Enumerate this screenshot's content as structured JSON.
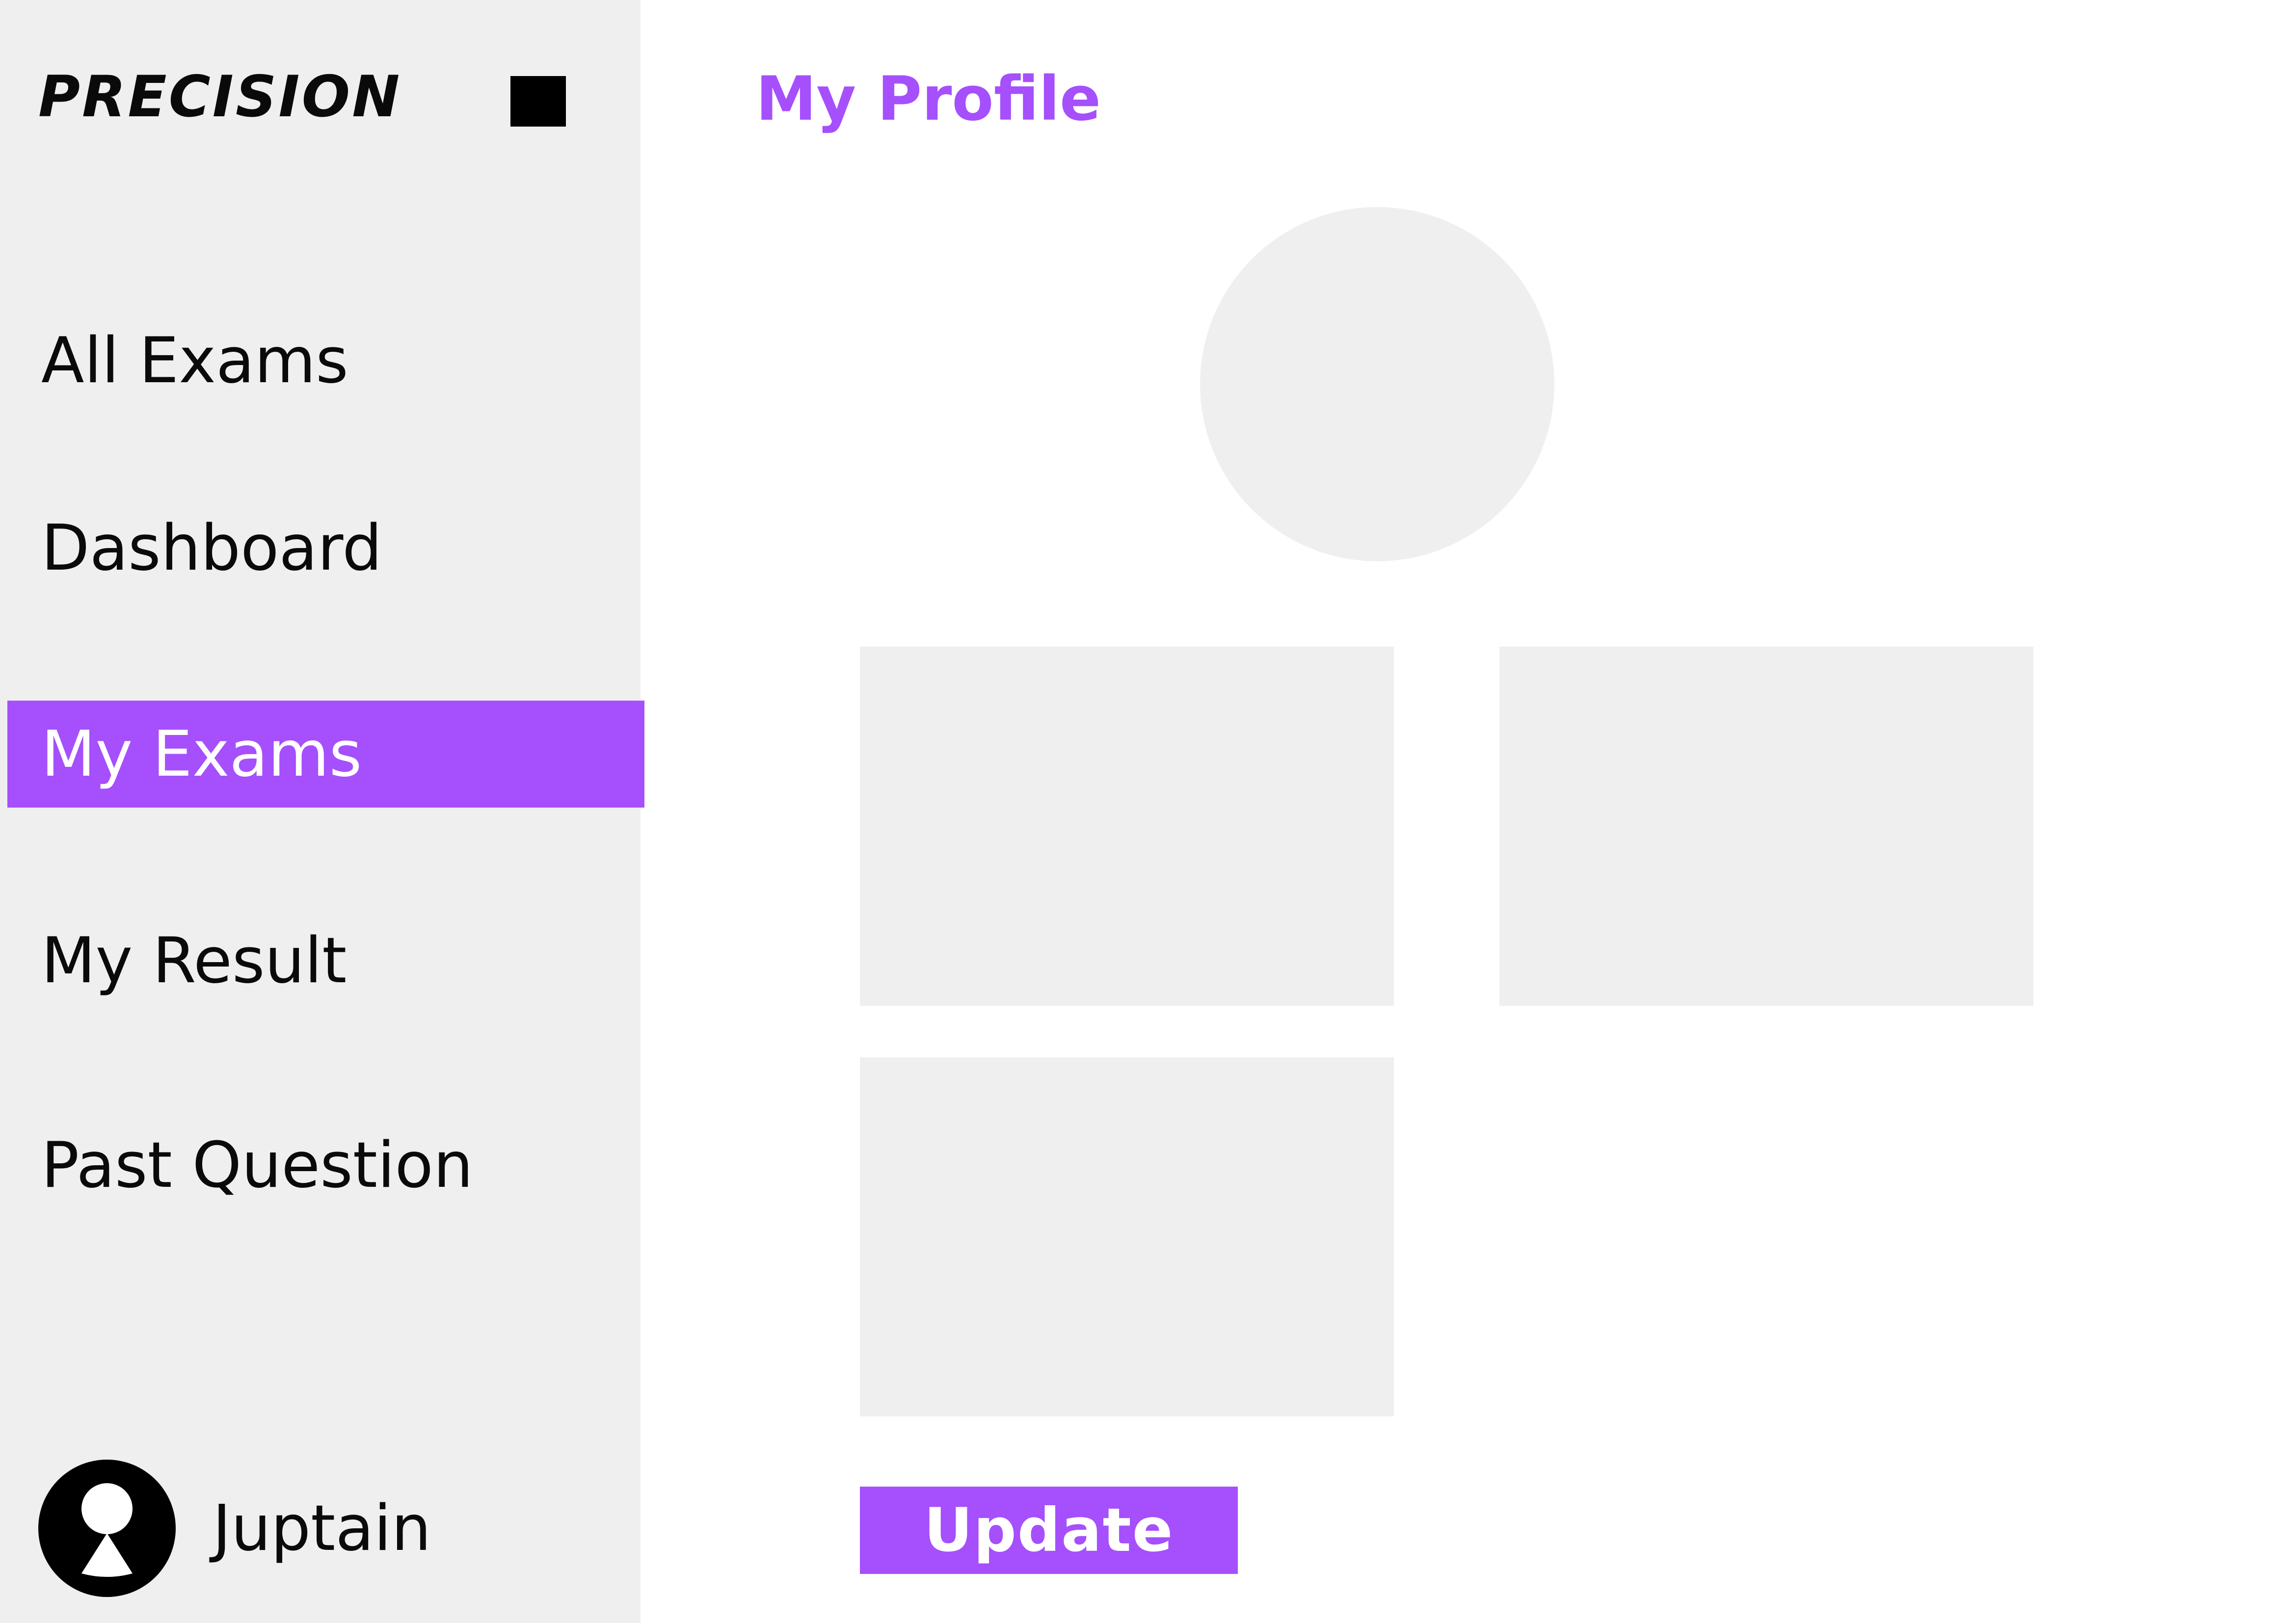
{
  "brand": {
    "name": "PRECISION"
  },
  "sidebar": {
    "menu_icon": "menu-square-icon",
    "items": [
      {
        "label": "All Exams",
        "active": false
      },
      {
        "label": "Dashboard",
        "active": false
      },
      {
        "label": "My Exams",
        "active": true
      },
      {
        "label": "My Result",
        "active": false
      },
      {
        "label": "Past Question",
        "active": false
      }
    ],
    "user": {
      "name": "Juptain",
      "avatar_icon": "user-avatar-icon"
    }
  },
  "main": {
    "title": "My Profile",
    "update_label": "Update"
  },
  "colors": {
    "accent": "#a64ffc",
    "sidebar_bg": "#efefef",
    "placeholder_bg": "#efefef",
    "text": "#0a0a0a"
  }
}
